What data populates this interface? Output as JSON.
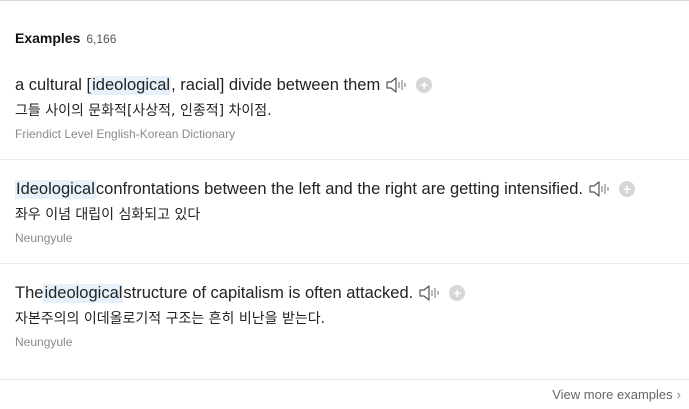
{
  "header": {
    "title": "Examples",
    "count": "6,166"
  },
  "examples": [
    {
      "sentence_parts": [
        "a cultural [",
        "ideological",
        ", racial] divide between them"
      ],
      "translation": "그들 사이의 문화적[사상적, 인종적] 차이점.",
      "source": "Friendict Level English-Korean Dictionary"
    },
    {
      "sentence_parts": [
        "",
        "Ideological",
        " confrontations between the left and the right are getting intensified."
      ],
      "translation": "좌우 이념 대립이 심화되고 있다",
      "source": "Neungyule"
    },
    {
      "sentence_parts": [
        "The ",
        "ideological",
        " structure of capitalism is often attacked."
      ],
      "translation": "자본주의의 이데올로기적 구조는 흔히 비난을 받는다.",
      "source": "Neungyule"
    }
  ],
  "icons": {
    "speaker": "speaker-icon",
    "add": "add-icon",
    "chevron": "chevron-right-icon"
  },
  "add_symbol": "+",
  "footer": {
    "more_label": "View more examples",
    "chevron": "›"
  }
}
